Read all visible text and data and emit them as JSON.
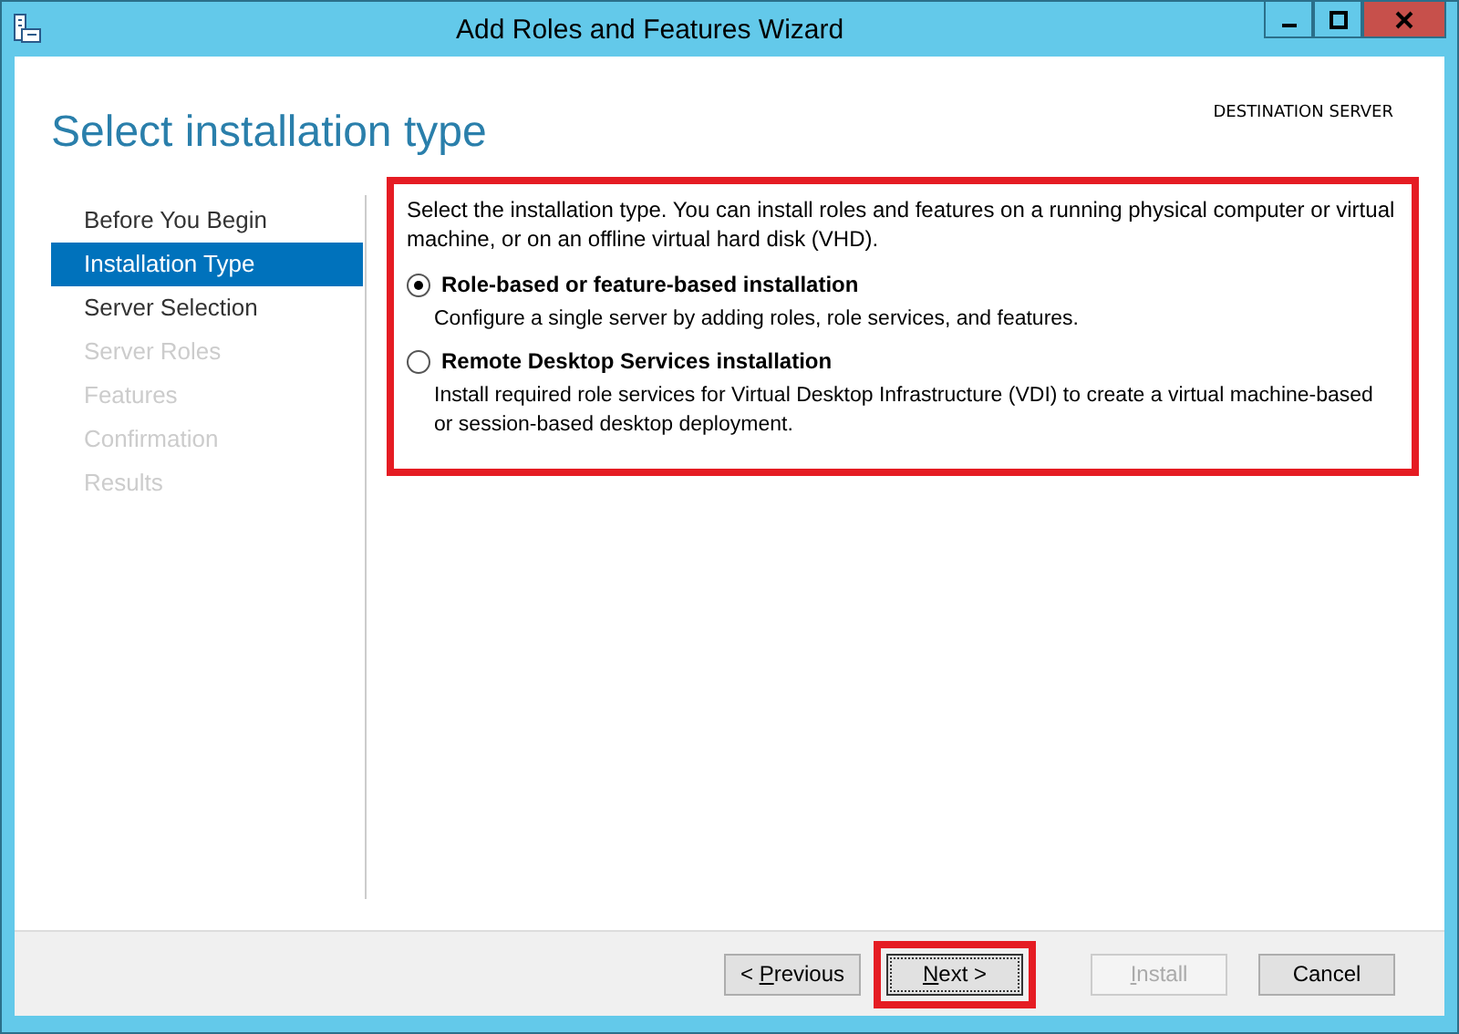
{
  "window": {
    "title": "Add Roles and Features Wizard"
  },
  "header": {
    "title": "Select installation type",
    "destination_label": "DESTINATION SERVER"
  },
  "steps": [
    {
      "label": "Before You Begin",
      "selected": false,
      "disabled": false
    },
    {
      "label": "Installation Type",
      "selected": true,
      "disabled": false
    },
    {
      "label": "Server Selection",
      "selected": false,
      "disabled": false
    },
    {
      "label": "Server Roles",
      "selected": false,
      "disabled": true
    },
    {
      "label": "Features",
      "selected": false,
      "disabled": true
    },
    {
      "label": "Confirmation",
      "selected": false,
      "disabled": true
    },
    {
      "label": "Results",
      "selected": false,
      "disabled": true
    }
  ],
  "content": {
    "highlighted": true,
    "intro": "Select the installation type. You can install roles and features on a running physical computer or virtual machine, or on an offline virtual hard disk (VHD).",
    "options": [
      {
        "label": "Role-based or feature-based installation",
        "description": "Configure a single server by adding roles, role services, and features.",
        "selected": true
      },
      {
        "label": "Remote Desktop Services installation",
        "description": "Install required role services for Virtual Desktop Infrastructure (VDI) to create a virtual machine-based or session-based desktop deployment.",
        "selected": false
      }
    ]
  },
  "buttons": [
    {
      "before": "< ",
      "key": "P",
      "after": "revious",
      "disabled": false,
      "focused": false,
      "highlighted": false
    },
    {
      "key": "N",
      "after": "ext >",
      "disabled": false,
      "focused": true,
      "highlighted": true
    },
    {
      "key": "I",
      "after": "nstall",
      "disabled": true,
      "focused": false,
      "highlighted": false
    },
    {
      "before": "Cancel",
      "disabled": false,
      "focused": false,
      "highlighted": false
    }
  ]
}
